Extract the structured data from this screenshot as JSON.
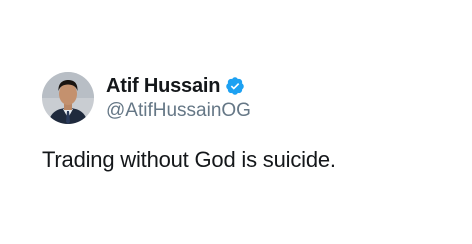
{
  "tweet": {
    "author": {
      "display_name": "Atif Hussain",
      "handle": "@AtifHussainOG",
      "verified": true
    },
    "text": "Trading without God is suicide."
  },
  "colors": {
    "text_primary": "#14171a",
    "text_secondary": "#657786",
    "verified_badge": "#1da1f2",
    "background": "#ffffff"
  },
  "icons": {
    "badge": "verified-badge-icon",
    "avatar": "profile-photo"
  }
}
